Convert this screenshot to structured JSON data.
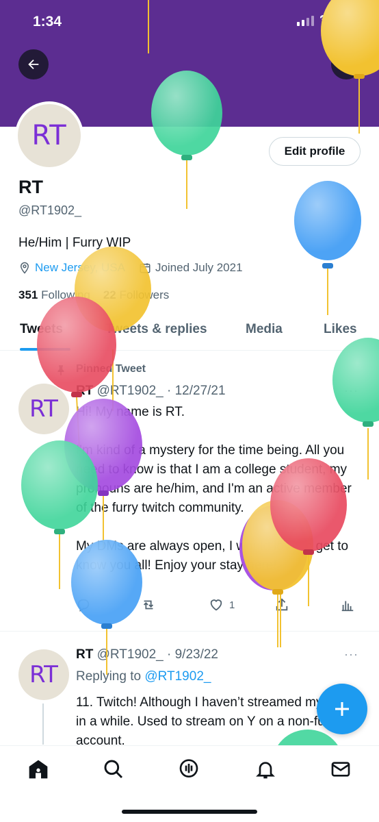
{
  "status_bar": {
    "time": "1:34"
  },
  "header": {
    "back_icon": "arrow-left-icon",
    "search_icon": "search-icon",
    "banner_color": "#5c2d91"
  },
  "profile": {
    "avatar_text": "RT",
    "edit_button": "Edit profile",
    "name": "RT",
    "handle": "@RT1902_",
    "bio": "He/Him | Furry WIP",
    "location": "New Jersey, USA",
    "joined": "Joined July 2021",
    "following_count": "351",
    "following_label": "Following",
    "followers_count": "22",
    "followers_label": "Followers"
  },
  "tabs": [
    {
      "label": "Tweets",
      "active": true
    },
    {
      "label": "Tweets & replies",
      "active": false
    },
    {
      "label": "Media",
      "active": false
    },
    {
      "label": "Likes",
      "active": false
    }
  ],
  "tweets": [
    {
      "pinned_label": "Pinned Tweet",
      "avatar_text": "RT",
      "author": "RT",
      "handle": "@RT1902_",
      "date": "· 12/27/21",
      "body": "Hi! My name is RT.\n\nI'm kind of a mystery for the time being. All you need to know is that I am a college student, my pronouns are he/him, and I'm an active member of the furry twitch community.\n\nMy DMs are always open, I would love to get to know you all! Enjoy your stay here!",
      "like_count": "1"
    },
    {
      "avatar_text": "RT",
      "author": "RT",
      "handle": "@RT1902_",
      "date": "· 9/23/22",
      "replying_label": "Replying to",
      "replying_to": "@RT1902_",
      "body": "11. Twitch! Although I haven’t streamed myself in a while. Used to stream on Y on a non-furry account."
    }
  ],
  "more_glyph": "···",
  "accent_color": "#1d9bf0",
  "balloon_colors": [
    "#f2c230",
    "#3fd59a",
    "#4da3f5",
    "#e84a5f",
    "#a44be0"
  ]
}
